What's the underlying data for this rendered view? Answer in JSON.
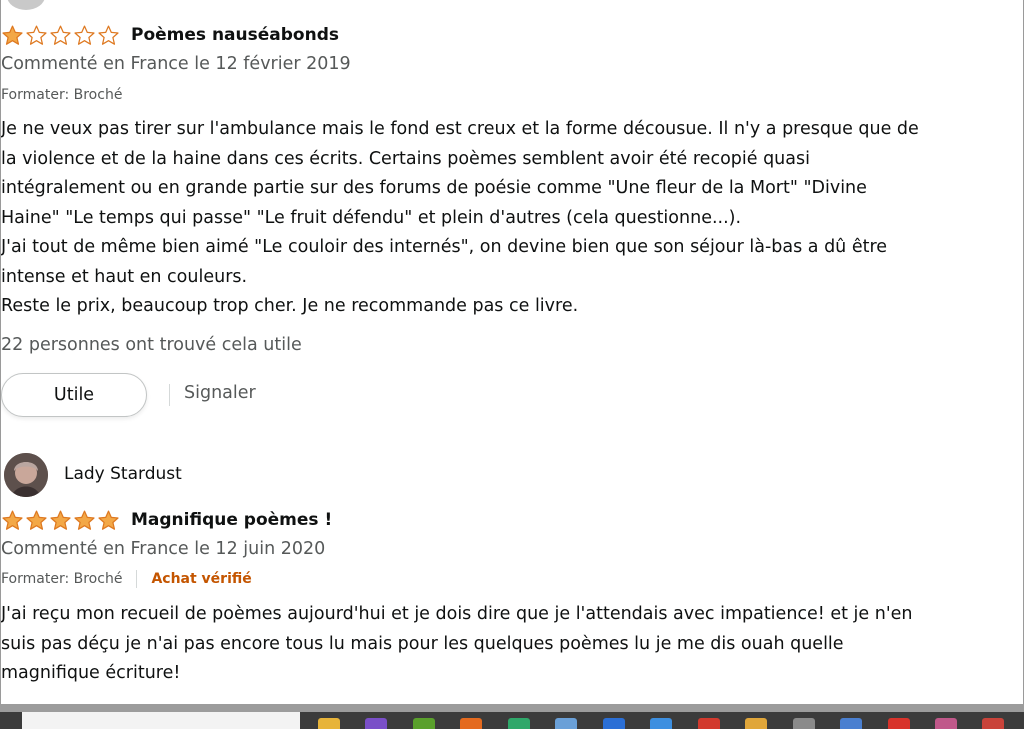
{
  "reviews": [
    {
      "rating": 1,
      "max_rating": 5,
      "title": "Poèmes nauséabonds",
      "date_text": "Commenté en France le 12 février 2019",
      "format": "Formater: Broché",
      "body": "Je ne veux pas tirer sur l'ambulance mais le fond est creux et la forme décousue. Il n'y a presque que de\nla violence et de la haine dans ces écrits. Certains poèmes semblent avoir été recopié quasi\nintégralement ou en grande partie sur des forums de poésie comme \"Une fleur de la Mort\" \"Divine\nHaine\" \"Le temps qui passe\" \"Le fruit défendu\" et plein d'autres (cela questionne...).\nJ'ai tout de même bien aimé \"Le couloir des internés\", on devine bien que son séjour là-bas a dû être\nintense et haut en couleurs.\nReste le prix, beaucoup trop cher. Je ne recommande pas ce livre.",
      "helpful_text": "22 personnes ont trouvé cela utile",
      "helpful_button": "Utile",
      "report_link": "Signaler"
    },
    {
      "author": "Lady Stardust",
      "rating": 5,
      "max_rating": 5,
      "title": "Magnifique poèmes !",
      "date_text": "Commenté en France le 12 juin 2020",
      "format": "Formater: Broché",
      "verified": "Achat vérifié",
      "body": "J'ai reçu mon recueil de poèmes aujourd'hui et je dois dire que je l'attendais avec impatience! et je n'en\nsuis pas déçu je n'ai pas encore tous lu mais pour les quelques poèmes lu je me dis ouah quelle\nmagnifique écriture!"
    }
  ],
  "colors": {
    "star": "#f3a847",
    "star_outline": "#de7921",
    "verified": "#c45500",
    "meta": "#565959",
    "text": "#0f1111"
  },
  "icons": [
    "star-filled-icon",
    "star-empty-icon",
    "avatar"
  ]
}
